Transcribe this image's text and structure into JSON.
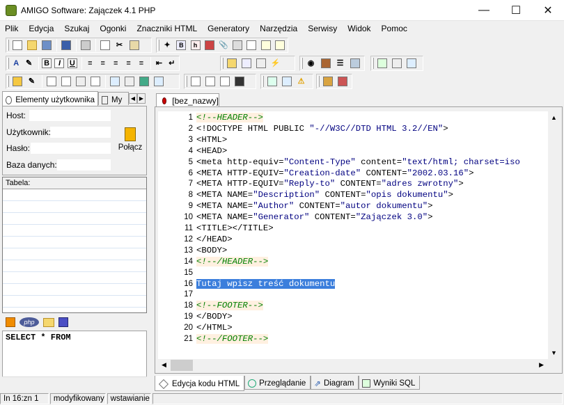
{
  "window": {
    "title": "AMIGO Software: Zajączek 4.1 PHP"
  },
  "menu": [
    "Plik",
    "Edycja",
    "Szukaj",
    "Ogonki",
    "Znaczniki HTML",
    "Generatory",
    "Narzędzia",
    "Serwisy",
    "Widok",
    "Pomoc"
  ],
  "toolbar": {
    "bold": "B",
    "italic": "I",
    "underline": "U"
  },
  "left_panel": {
    "tab_elements": "Elementy użytkownika",
    "tab_my": "My",
    "host_label": "Host:",
    "user_label": "Użytkownik:",
    "password_label": "Hasło:",
    "database_label": "Baza danych:",
    "connect_label": "Połącz",
    "table_label": "Tabela:",
    "sql_text": "SELECT * FROM"
  },
  "editor": {
    "tab_label": "[bez_nazwy]",
    "lines": [
      {
        "n": "1",
        "parts": [
          {
            "t": "<!--HEADER-->",
            "c": "cm"
          }
        ]
      },
      {
        "n": "2",
        "parts": [
          {
            "t": "<!DOCTYPE HTML PUBLIC ",
            "c": ""
          },
          {
            "t": "\"-//W3C//DTD HTML 3.2//EN\"",
            "c": "st"
          },
          {
            "t": ">",
            "c": ""
          }
        ]
      },
      {
        "n": "3",
        "parts": [
          {
            "t": "<HTML>",
            "c": ""
          }
        ]
      },
      {
        "n": "4",
        "parts": [
          {
            "t": "<HEAD>",
            "c": ""
          }
        ]
      },
      {
        "n": "5",
        "parts": [
          {
            "t": "<meta http-equiv=",
            "c": ""
          },
          {
            "t": "\"Content-Type\"",
            "c": "st"
          },
          {
            "t": " content=",
            "c": ""
          },
          {
            "t": "\"text/html; charset=iso",
            "c": "st"
          }
        ]
      },
      {
        "n": "6",
        "parts": [
          {
            "t": "<META HTTP-EQUIV=",
            "c": ""
          },
          {
            "t": "\"Creation-date\"",
            "c": "st"
          },
          {
            "t": " CONTENT=",
            "c": ""
          },
          {
            "t": "\"2002.03.16\"",
            "c": "st"
          },
          {
            "t": ">",
            "c": ""
          }
        ]
      },
      {
        "n": "7",
        "parts": [
          {
            "t": "<META HTTP-EQUIV=",
            "c": ""
          },
          {
            "t": "\"Reply-to\"",
            "c": "st"
          },
          {
            "t": " CONTENT=",
            "c": ""
          },
          {
            "t": "\"adres zwrotny\"",
            "c": "st"
          },
          {
            "t": ">",
            "c": ""
          }
        ]
      },
      {
        "n": "8",
        "parts": [
          {
            "t": "<META NAME=",
            "c": ""
          },
          {
            "t": "\"Description\"",
            "c": "st"
          },
          {
            "t": " CONTENT=",
            "c": ""
          },
          {
            "t": "\"opis dokumentu\"",
            "c": "st"
          },
          {
            "t": ">",
            "c": ""
          }
        ]
      },
      {
        "n": "9",
        "parts": [
          {
            "t": "<META NAME=",
            "c": ""
          },
          {
            "t": "\"Author\"",
            "c": "st"
          },
          {
            "t": " CONTENT=",
            "c": ""
          },
          {
            "t": "\"autor dokumentu\"",
            "c": "st"
          },
          {
            "t": ">",
            "c": ""
          }
        ]
      },
      {
        "n": "10",
        "parts": [
          {
            "t": "<META NAME=",
            "c": ""
          },
          {
            "t": "\"Generator\"",
            "c": "st"
          },
          {
            "t": " CONTENT=",
            "c": ""
          },
          {
            "t": "\"Zajączek 3.0\"",
            "c": "st"
          },
          {
            "t": ">",
            "c": ""
          }
        ]
      },
      {
        "n": "11",
        "parts": [
          {
            "t": "<TITLE></TITLE>",
            "c": ""
          }
        ]
      },
      {
        "n": "12",
        "parts": [
          {
            "t": "</HEAD>",
            "c": ""
          }
        ]
      },
      {
        "n": "13",
        "parts": [
          {
            "t": "<BODY>",
            "c": ""
          }
        ]
      },
      {
        "n": "14",
        "parts": [
          {
            "t": "<!--/HEADER-->",
            "c": "cm"
          }
        ]
      },
      {
        "n": "15",
        "parts": []
      },
      {
        "n": "16",
        "parts": [
          {
            "t": "Tutaj wpisz treść dokumentu",
            "c": "hl"
          }
        ]
      },
      {
        "n": "17",
        "parts": []
      },
      {
        "n": "18",
        "parts": [
          {
            "t": "<!--FOOTER-->",
            "c": "cm"
          }
        ]
      },
      {
        "n": "19",
        "parts": [
          {
            "t": "</BODY>",
            "c": ""
          }
        ]
      },
      {
        "n": "20",
        "parts": [
          {
            "t": "</HTML>",
            "c": ""
          }
        ]
      },
      {
        "n": "21",
        "parts": [
          {
            "t": "<!--/FOOTER-->",
            "c": "cm"
          }
        ]
      }
    ]
  },
  "bottom_tabs": [
    "Edycja kodu HTML",
    "Przeglądanie",
    "Diagram",
    "Wyniki SQL"
  ],
  "status": {
    "position": "In 16:zn 1",
    "modified": "modyfikowany",
    "mode": "wstawianie"
  },
  "colors": {
    "selection": "#3b7edc",
    "comment": "#008000",
    "string": "#000080"
  }
}
